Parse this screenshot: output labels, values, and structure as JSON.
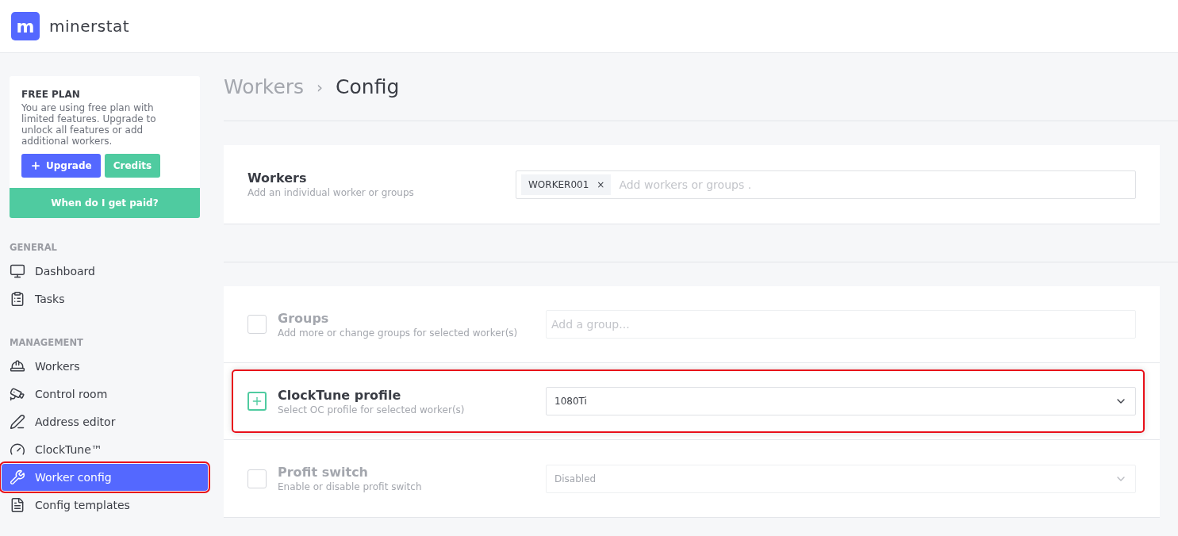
{
  "header": {
    "logo_letter": "m",
    "brand": "minerstat"
  },
  "plan": {
    "title": "FREE PLAN",
    "text": "You are using free plan with limited features. Upgrade to unlock all features or add additional workers.",
    "buttons": [
      {
        "label": "Upgrade",
        "kind": "primary"
      },
      {
        "label": "Credits",
        "kind": "secondary"
      }
    ],
    "paid_button": "When do I get paid?"
  },
  "nav_sections": [
    {
      "title": "GENERAL",
      "items": [
        {
          "label": "Dashboard",
          "selected": false,
          "highlighted": false
        },
        {
          "label": "Tasks",
          "selected": false,
          "highlighted": false
        }
      ]
    },
    {
      "title": "MANAGEMENT",
      "items": [
        {
          "label": "Workers",
          "selected": false,
          "highlighted": false
        },
        {
          "label": "Control room",
          "selected": false,
          "highlighted": false
        },
        {
          "label": "Address editor",
          "selected": false,
          "highlighted": false
        },
        {
          "label": "ClockTune™",
          "selected": false,
          "highlighted": false
        },
        {
          "label": "Worker config",
          "selected": true,
          "highlighted": true
        },
        {
          "label": "Config templates",
          "selected": false,
          "highlighted": false
        }
      ]
    }
  ],
  "breadcrumb": [
    "Workers",
    "Config"
  ],
  "breadcrumb_separator": "›",
  "workers": {
    "title": "Workers",
    "subtitle": "Add an individual worker or groups",
    "tags": [
      "WORKER001"
    ],
    "tag_remove": "×",
    "placeholder": "Add workers or groups ."
  },
  "settings": [
    {
      "title": "Groups",
      "subtitle": "Add more or change groups for selected worker(s)",
      "kind": "input",
      "checked": false,
      "highlighted": false,
      "placeholder": "Add a group..."
    },
    {
      "title": "ClockTune profile",
      "subtitle": "Select OC profile for selected worker(s)",
      "kind": "select",
      "checked": true,
      "highlighted": true,
      "value": "1080Ti"
    },
    {
      "title": "Profit switch",
      "subtitle": "Enable or disable profit switch",
      "kind": "select",
      "checked": false,
      "highlighted": false,
      "value": "Disabled"
    }
  ]
}
